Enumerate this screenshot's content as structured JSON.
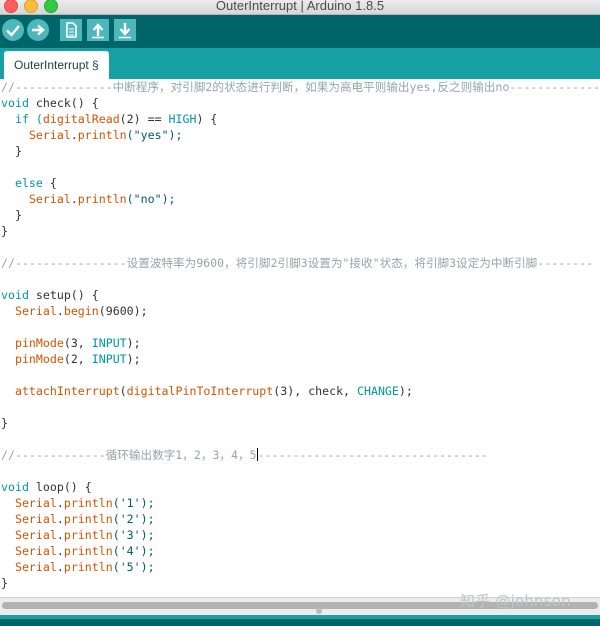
{
  "window": {
    "title": "OuterInterrupt | Arduino 1.8.5"
  },
  "toolbar": {
    "buttons": [
      {
        "name": "verify-button",
        "icon": "checkmark-icon"
      },
      {
        "name": "upload-button",
        "icon": "arrow-right-icon"
      },
      {
        "name": "new-button",
        "icon": "document-icon"
      },
      {
        "name": "open-button",
        "icon": "arrow-up-icon"
      },
      {
        "name": "save-button",
        "icon": "arrow-down-icon"
      }
    ]
  },
  "tabs": [
    {
      "label": "OuterInterrupt §"
    }
  ],
  "code": {
    "l1": "//--------------中断程序，对引脚2的状态进行判断，如果为高电平则输出yes,反之则输出no--------------",
    "l2a": "void",
    "l2b": " check() {",
    "l3a": "  if (",
    "l3b": "digitalRead",
    "l3c": "(2) == ",
    "l3d": "HIGH",
    "l3e": ") {",
    "l4a": "    ",
    "l4b": "Serial",
    "l4c": ".",
    "l4d": "println",
    "l4e": "(\"yes\");",
    "l5": "  }",
    "l7a": "  else",
    "l7b": " {",
    "l8a": "    ",
    "l8b": "Serial",
    "l8c": ".",
    "l8d": "println",
    "l8e": "(\"no\");",
    "l9": "  }",
    "l10": "}",
    "l12": "//----------------设置波特率为9600，将引脚2引脚3设置为\"接收\"状态，将引脚3设定为中断引脚--------",
    "l14a": "void",
    "l14b": " setup() {",
    "l15a": "  ",
    "l15b": "Serial",
    "l15c": ".",
    "l15d": "begin",
    "l15e": "(9600);",
    "l17a": "  ",
    "l17b": "pinMode",
    "l17c": "(3, ",
    "l17d": "INPUT",
    "l17e": ");",
    "l18a": "  ",
    "l18b": "pinMode",
    "l18c": "(2, ",
    "l18d": "INPUT",
    "l18e": ");",
    "l20a": "  ",
    "l20b": "attachInterrupt",
    "l20c": "(",
    "l20d": "digitalPinToInterrupt",
    "l20e": "(3), check, ",
    "l20f": "CHANGE",
    "l20g": ");",
    "l22": "}",
    "l24a": "//-------------循环输出数字1，2，3，4，5",
    "l24b": "---------------------------------",
    "l26a": "void",
    "l26b": " loop() {",
    "l27a": "  ",
    "l27b": "Serial",
    "l27c": ".",
    "l27d": "println",
    "l27e": "('1');",
    "l28a": "  ",
    "l28b": "Serial",
    "l28c": ".",
    "l28d": "println",
    "l28e": "('2');",
    "l29a": "  ",
    "l29b": "Serial",
    "l29c": ".",
    "l29d": "println",
    "l29e": "('3');",
    "l30a": "  ",
    "l30b": "Serial",
    "l30c": ".",
    "l30d": "println",
    "l30e": "('4');",
    "l31a": "  ",
    "l31b": "Serial",
    "l31c": ".",
    "l31d": "println",
    "l31e": "('5');",
    "l32": "}"
  },
  "watermark": "知乎 @johnson",
  "colors": {
    "toolbar": "#006468",
    "tabbar": "#17a1a5",
    "keyword": "#00979c",
    "function": "#d35400",
    "comment": "#95a5a6"
  }
}
